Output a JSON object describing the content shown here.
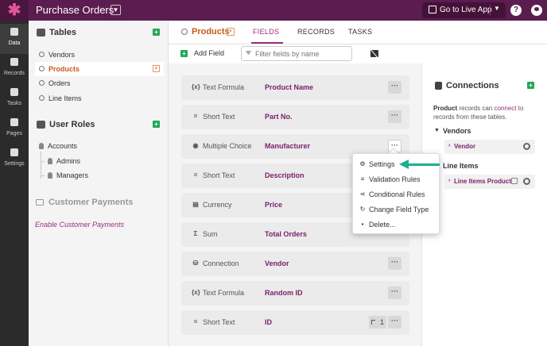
{
  "app": {
    "logo_glyph": "✱",
    "title": "Purchase Orders",
    "live_app_label": "Go to Live App",
    "help_glyph": "?"
  },
  "leftnav": [
    {
      "label": "Data",
      "icon": "database-icon"
    },
    {
      "label": "Records",
      "icon": "records-icon"
    },
    {
      "label": "Tasks",
      "icon": "lightning-icon"
    },
    {
      "label": "Pages",
      "icon": "pages-icon"
    },
    {
      "label": "Settings",
      "icon": "gear-icon"
    }
  ],
  "tables": {
    "title": "Tables",
    "items": [
      {
        "label": "Vendors"
      },
      {
        "label": "Products"
      },
      {
        "label": "Orders"
      },
      {
        "label": "Line Items"
      }
    ]
  },
  "user_roles": {
    "title": "User Roles",
    "accounts": "Accounts",
    "children": [
      "Admins",
      "Managers"
    ]
  },
  "customer_payments": {
    "title": "Customer Payments",
    "link": "Enable Customer Payments"
  },
  "header": {
    "table_name": "Products",
    "tabs": [
      "FIELDS",
      "RECORDS",
      "TASKS"
    ]
  },
  "toolbar": {
    "add_field": "Add Field",
    "filter_placeholder": "Filter fields by name"
  },
  "fields": [
    {
      "type": "Text Formula",
      "type_glyph": "{x}",
      "name": "Product Name"
    },
    {
      "type": "Short Text",
      "type_glyph": "=",
      "name": "Part No."
    },
    {
      "type": "Multiple Choice",
      "type_glyph": "◉",
      "name": "Manufacturer"
    },
    {
      "type": "Short Text",
      "type_glyph": "=",
      "name": "Description"
    },
    {
      "type": "Currency",
      "type_glyph": "▤",
      "name": "Price"
    },
    {
      "type": "Sum",
      "type_glyph": "Σ",
      "name": "Total Orders"
    },
    {
      "type": "Connection",
      "type_glyph": "⛁",
      "name": "Vendor"
    },
    {
      "type": "Text Formula",
      "type_glyph": "{x}",
      "name": "Random ID"
    },
    {
      "type": "Short Text",
      "type_glyph": "=",
      "name": "ID",
      "badge": "1"
    }
  ],
  "more_glyph": "···",
  "menu": [
    {
      "label": "Settings",
      "icon": "⚙"
    },
    {
      "label": "Validation Rules",
      "icon": "≡"
    },
    {
      "label": "Conditional Rules",
      "icon": "⋖"
    },
    {
      "label": "Change Field Type",
      "icon": "↻"
    },
    {
      "label": "Delete...",
      "icon": "▪"
    }
  ],
  "connections": {
    "title": "Connections",
    "desc_bold": "Product",
    "desc_mid": " records can ",
    "desc_link": "connect",
    "desc_end": " to records from these tables.",
    "groups": [
      {
        "label": "Vendors",
        "item": "Vendor"
      },
      {
        "label": "Line Items",
        "item": "Line Items Product"
      }
    ]
  },
  "colors": {
    "brand": "#5b1d4f",
    "accent": "#9b2d7f",
    "active_table": "#c75a1a",
    "add": "#22a85a",
    "annotation": "#1fae94"
  }
}
